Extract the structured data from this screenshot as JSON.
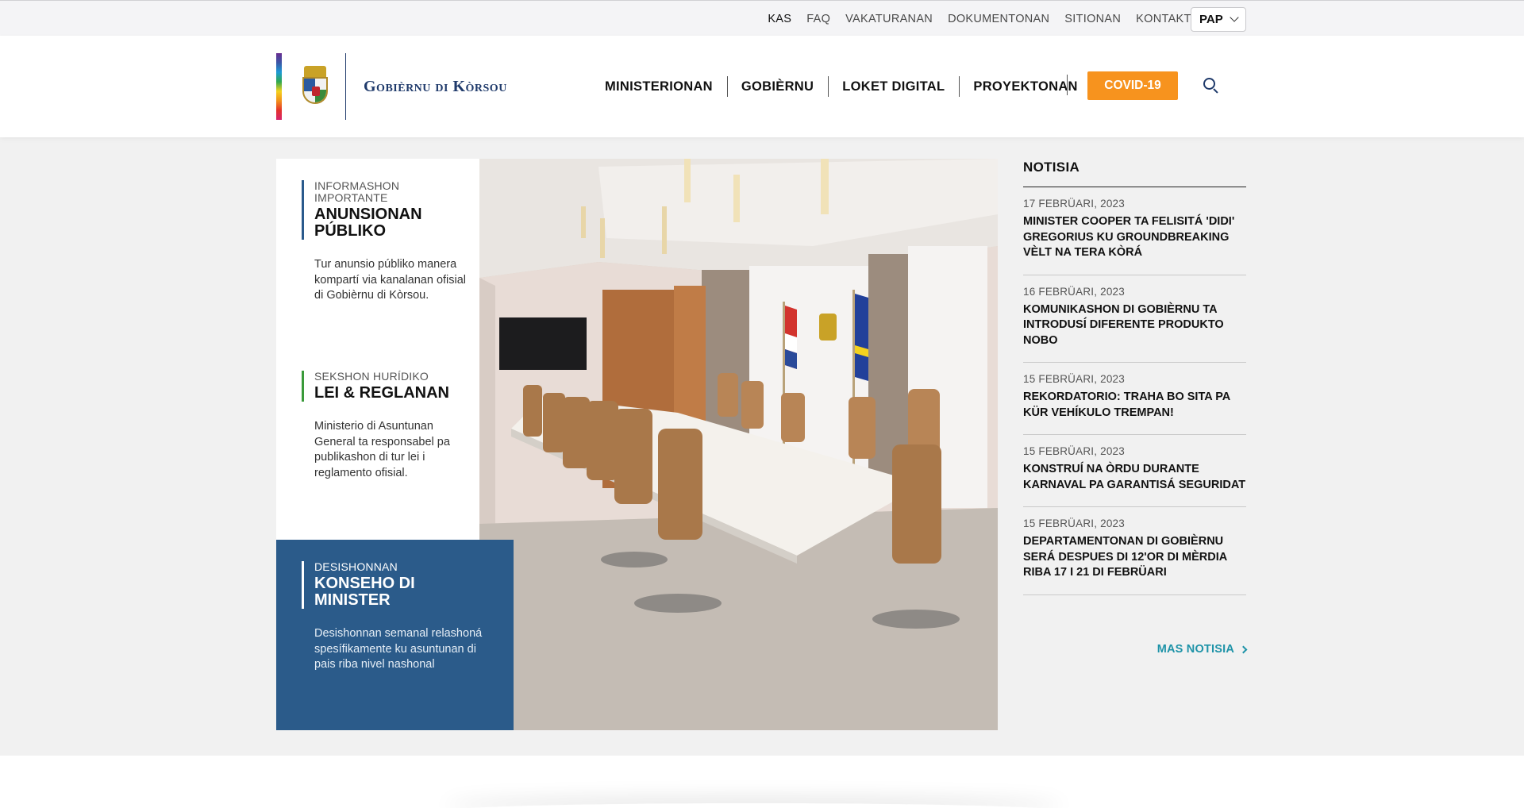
{
  "utility_nav": {
    "links": [
      "KAS",
      "FAQ",
      "VAKATURANAN",
      "DOKUMENTONAN",
      "SITIONAN",
      "KONTAKTO"
    ],
    "language": "PAP"
  },
  "header": {
    "logo_text": "Gobièrnu di Kòrsou",
    "nav": [
      "MINISTERIONAN",
      "GOBIÈRNU",
      "LOKET DIGITAL",
      "PROYEKTONAN"
    ],
    "cta": "COVID-19"
  },
  "hero": {
    "blocks": [
      {
        "eyebrow": "INFORMASHON IMPORTANTE",
        "title": "ANUNSIONAN PÚBLIKO",
        "desc": "Tur anunsio públiko manera kompartí via kanalanan ofisial di Gobièrnu di Kòrsou."
      },
      {
        "eyebrow": "SEKSHON HURÍDIKO",
        "title": "LEI & REGLANAN",
        "desc": "Ministerio di Asuntunan General ta responsabel pa publikashon di tur lei i reglamento ofisial."
      },
      {
        "eyebrow": "DESISHONNAN",
        "title": "KONSEHO DI MINISTER",
        "desc": "Desishonnan semanal relashoná spesífikamente ku asuntunan di pais riba nivel nashonal"
      }
    ]
  },
  "news": {
    "heading": "NOTISIA",
    "items": [
      {
        "date": "17 FEBRÜARI, 2023",
        "title": "MINISTER COOPER TA FELISITÁ 'DIDI' GREGORIUS KU GROUNDBREAKING VÈLT NA TERA KÒRÁ"
      },
      {
        "date": "16 FEBRÜARI, 2023",
        "title": "KOMUNIKASHON DI GOBIÈRNU TA INTRODUSÍ DIFERENTE PRODUKTO NOBO"
      },
      {
        "date": "15 FEBRÜARI, 2023",
        "title": "REKORDATORIO: TRAHA BO SITA PA KÜR VEHÍKULO TREMPAN!"
      },
      {
        "date": "15 FEBRÜARI, 2023",
        "title": "KONSTRUÍ NA ÒRDU DURANTE KARNAVAL PA GARANTISÁ SEGURIDAT"
      },
      {
        "date": "15 FEBRÜARI, 2023",
        "title": "DEPARTAMENTONAN DI GOBIÈRNU SERÁ DESPUES DI 12'OR DI MÈRDIA RIBA 17 I 21 DI FEBRÜARI"
      }
    ],
    "more": "MAS NOTISIA"
  },
  "colors": {
    "accent_orange": "#f7931e",
    "panel_blue": "#2b5b8a",
    "link_teal": "#1e93a8",
    "brand_navy": "#1f3a6b"
  }
}
